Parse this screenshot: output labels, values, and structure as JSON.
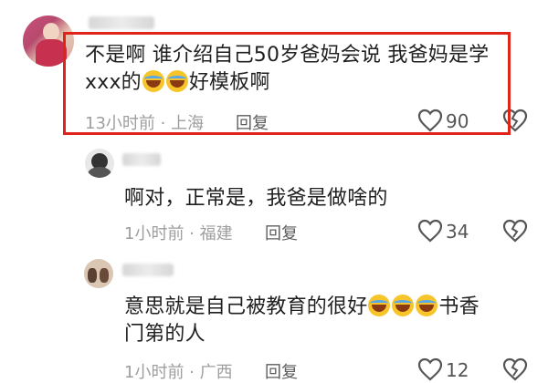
{
  "comment1": {
    "text_line1": "不是啊 谁介绍自己50岁爸妈会说 我爸妈是学",
    "text_line2_prefix": "xxx的",
    "text_line2_suffix": "好模板啊",
    "meta": "13小时前 · 上海",
    "reply_label": "回复",
    "likes": "90",
    "emoji_count": 2
  },
  "comment2": {
    "text": "啊对，正常是，我爸是做啥的",
    "meta": "1小时前 · 福建",
    "reply_label": "回复",
    "likes": "34"
  },
  "comment3": {
    "text_line1_prefix": "意思就是自己被教育的很好",
    "text_line1_suffix": "书香",
    "text_line2": "门第的人",
    "meta": "1小时前 · 广西",
    "reply_label": "回复",
    "likes": "12",
    "emoji_count": 3
  },
  "colors": {
    "highlight_border": "#e0241a",
    "meta_text": "#9e9e9e",
    "emoji_face": "#f7c52a"
  },
  "icons": [
    "heart-outline-icon",
    "broken-heart-icon",
    "laughing-crying-emoji"
  ]
}
